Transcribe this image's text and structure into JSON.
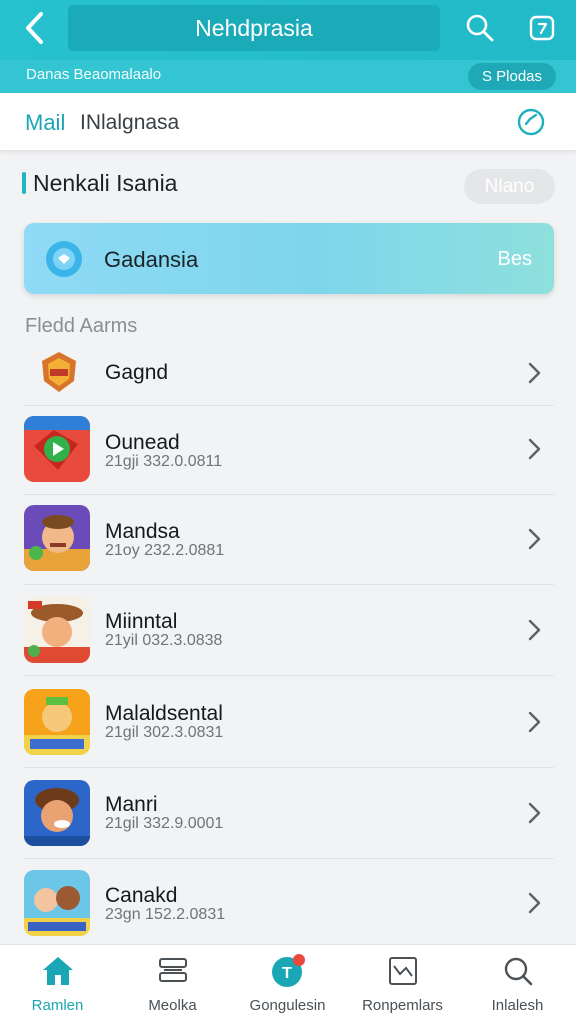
{
  "topbar": {
    "title": "Nehdprasia"
  },
  "subbar": {
    "text": "Danas Beaomalaalo",
    "pill": "S Plodas"
  },
  "mailrow": {
    "label": "Mail",
    "value": "INlalgnasa"
  },
  "section": {
    "title": "Nenkali Isania",
    "button": "Nlano"
  },
  "banner": {
    "label": "Gadansia",
    "right": "Bes"
  },
  "list": {
    "heading": "Fledd Aarms",
    "items": [
      {
        "name": "Gagnd",
        "sub": ""
      },
      {
        "name": "Ounead",
        "sub": "21gji  332.0.0811"
      },
      {
        "name": "Mandsa",
        "sub": "21oy  232.2.0881"
      },
      {
        "name": "Miinntal",
        "sub": "21yil  032.3.0838"
      },
      {
        "name": "Malaldsental",
        "sub": "21gil  302.3.0831"
      },
      {
        "name": "Manri",
        "sub": "21gil  332.9.0001"
      },
      {
        "name": "Canakd",
        "sub": "23gn  152.2.0831"
      }
    ]
  },
  "nav": {
    "items": [
      {
        "label": "Ramlen"
      },
      {
        "label": "Meolka"
      },
      {
        "label": "Gongulesin"
      },
      {
        "label": "Ronpemlars"
      },
      {
        "label": "Inlalesh"
      }
    ]
  },
  "colors": {
    "accent": "#22b9c8",
    "badge": "#e8493b"
  }
}
